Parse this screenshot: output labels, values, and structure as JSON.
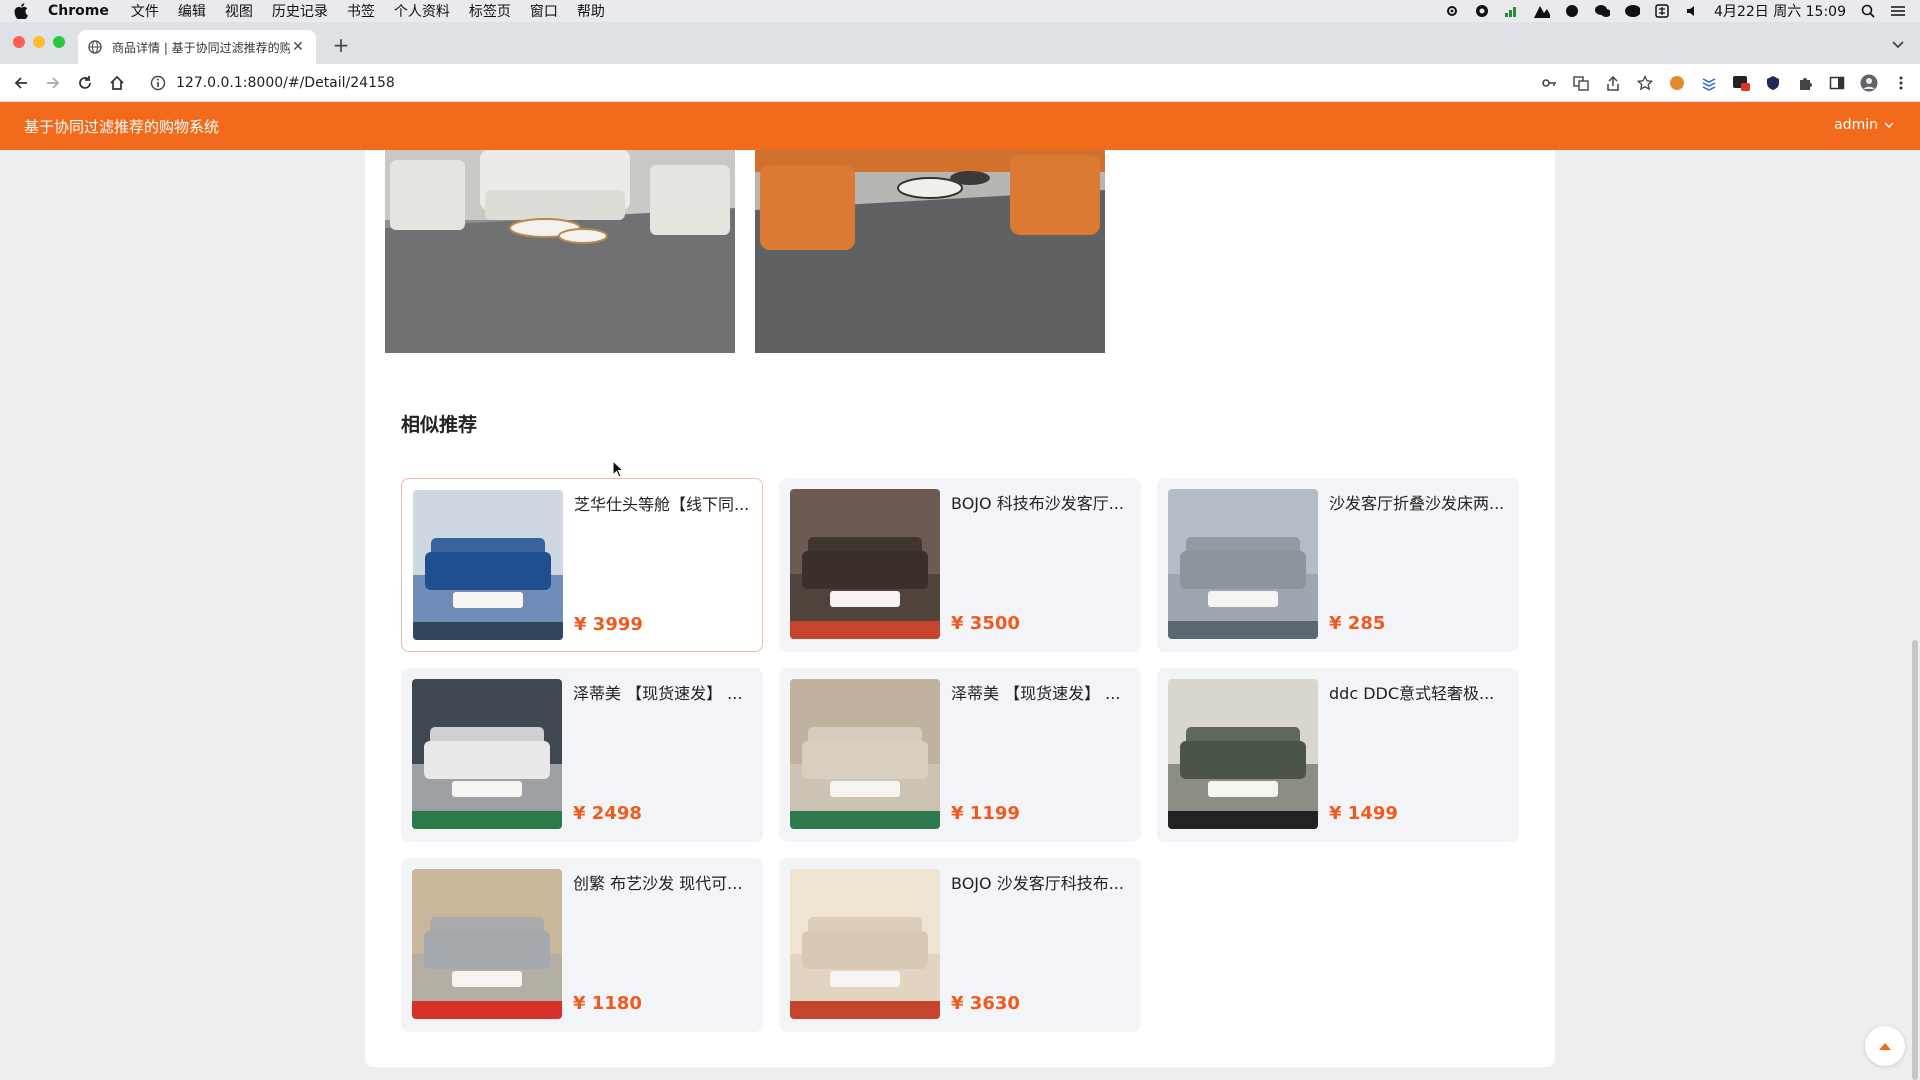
{
  "menubar": {
    "app": "Chrome",
    "items": [
      "文件",
      "编辑",
      "视图",
      "历史记录",
      "书签",
      "个人资料",
      "标签页",
      "窗口",
      "帮助"
    ],
    "datetime": "4月22日 周六  15:09"
  },
  "browser": {
    "tab_title": "商品详情 | 基于协同过滤推荐的购",
    "url": "127.0.0.1:8000/#/Detail/24158"
  },
  "app": {
    "title": "基于协同过滤推荐的购物系统",
    "user": "admin"
  },
  "section": {
    "title": "相似推荐"
  },
  "recommendations": [
    {
      "name": "芝华仕头等舱【线下同...",
      "price": "¥ 3999",
      "thumb_colors": [
        "#1f4f8f",
        "#cfd7e2",
        "#32465e"
      ]
    },
    {
      "name": "BOJO 科技布沙发客厅...",
      "price": "¥ 3500",
      "thumb_colors": [
        "#3a2f2a",
        "#6b5b52",
        "#c5452c"
      ]
    },
    {
      "name": "沙发客厅折叠沙发床两...",
      "price": "¥ 285",
      "thumb_colors": [
        "#8d949c",
        "#b4bcc6",
        "#5b6773"
      ]
    },
    {
      "name": "泽蒂美 【现货速发】 ...",
      "price": "¥ 2498",
      "thumb_colors": [
        "#e9e9e9",
        "#3f4753",
        "#2c7a4a"
      ]
    },
    {
      "name": "泽蒂美 【现货速发】 ...",
      "price": "¥ 1199",
      "thumb_colors": [
        "#d9cfc1",
        "#bfb3a0",
        "#2f7a4d"
      ]
    },
    {
      "name": "ddc DDC意式轻奢极...",
      "price": "¥ 1499",
      "thumb_colors": [
        "#4a5448",
        "#d9d6cf",
        "#222222"
      ]
    },
    {
      "name": "创繁 布艺沙发 现代可...",
      "price": "¥ 1180",
      "thumb_colors": [
        "#a4a9ad",
        "#c8b79a",
        "#d9302a"
      ]
    },
    {
      "name": "BOJO 沙发客厅科技布...",
      "price": "¥ 3630",
      "thumb_colors": [
        "#d8c9b5",
        "#efe3d1",
        "#c5452c"
      ]
    }
  ],
  "colors": {
    "accent": "#f26a1b",
    "price": "#ef5b1f"
  }
}
